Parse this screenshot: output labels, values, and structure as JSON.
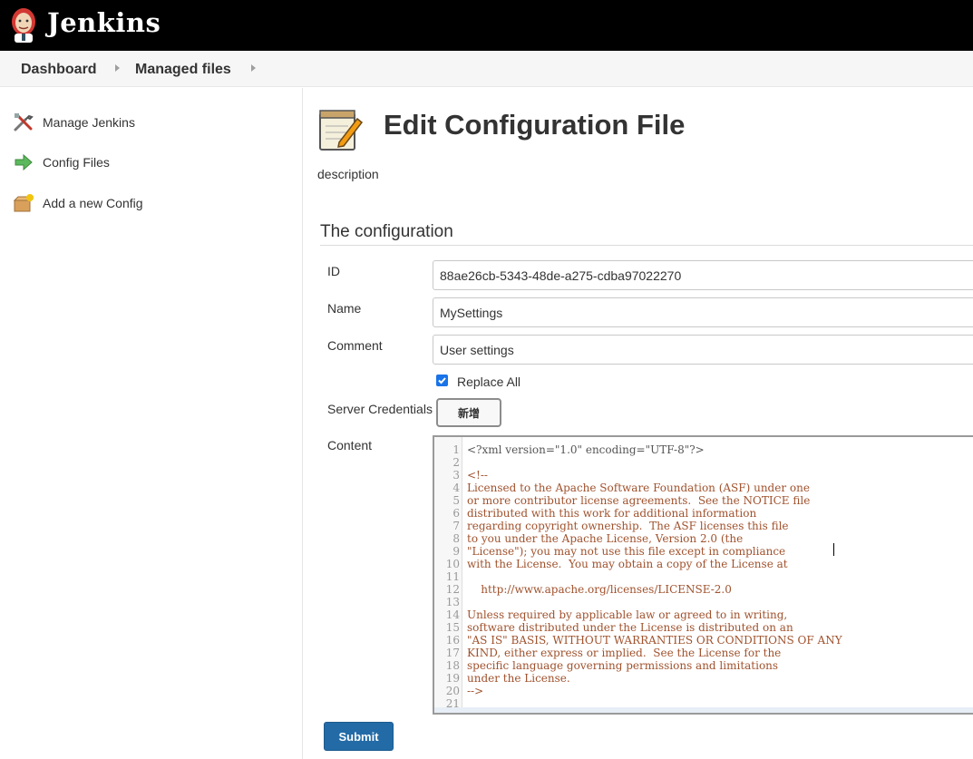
{
  "header": {
    "brand": "Jenkins"
  },
  "breadcrumb": {
    "items": [
      "Dashboard",
      "Managed files"
    ]
  },
  "sidebar": {
    "items": [
      {
        "label": "Manage Jenkins",
        "icon": "tools-icon"
      },
      {
        "label": "Config Files",
        "icon": "arrow-right-icon"
      },
      {
        "label": "Add a new Config",
        "icon": "package-add-icon"
      }
    ]
  },
  "main": {
    "title": "Edit Configuration File",
    "description": "description",
    "section_title": "The configuration",
    "fields": {
      "id_label": "ID",
      "id_value": "88ae26cb-5343-48de-a275-cdba97022270",
      "name_label": "Name",
      "name_value": "MySettings",
      "comment_label": "Comment",
      "comment_value": "User settings",
      "replace_all_label": "Replace All",
      "replace_all_checked": true,
      "credentials_label": "Server Credentials",
      "add_button_label": "新增",
      "content_label": "Content"
    },
    "content_lines": [
      "<?xml version=\"1.0\" encoding=\"UTF-8\"?>",
      "",
      "<!--",
      "Licensed to the Apache Software Foundation (ASF) under one",
      "or more contributor license agreements.  See the NOTICE file",
      "distributed with this work for additional information",
      "regarding copyright ownership.  The ASF licenses this file",
      "to you under the Apache License, Version 2.0 (the",
      "\"License\"); you may not use this file except in compliance",
      "with the License.  You may obtain a copy of the License at",
      "",
      "    http://www.apache.org/licenses/LICENSE-2.0",
      "",
      "Unless required by applicable law or agreed to in writing,",
      "software distributed under the License is distributed on an",
      "\"AS IS\" BASIS, WITHOUT WARRANTIES OR CONDITIONS OF ANY",
      "KIND, either express or implied.  See the License for the",
      "specific language governing permissions and limitations",
      "under the License.",
      "-->",
      ""
    ],
    "submit_label": "Submit"
  },
  "colors": {
    "header_bg": "#000000",
    "submit_bg": "#236ba6",
    "comment_text": "#a0522d"
  }
}
